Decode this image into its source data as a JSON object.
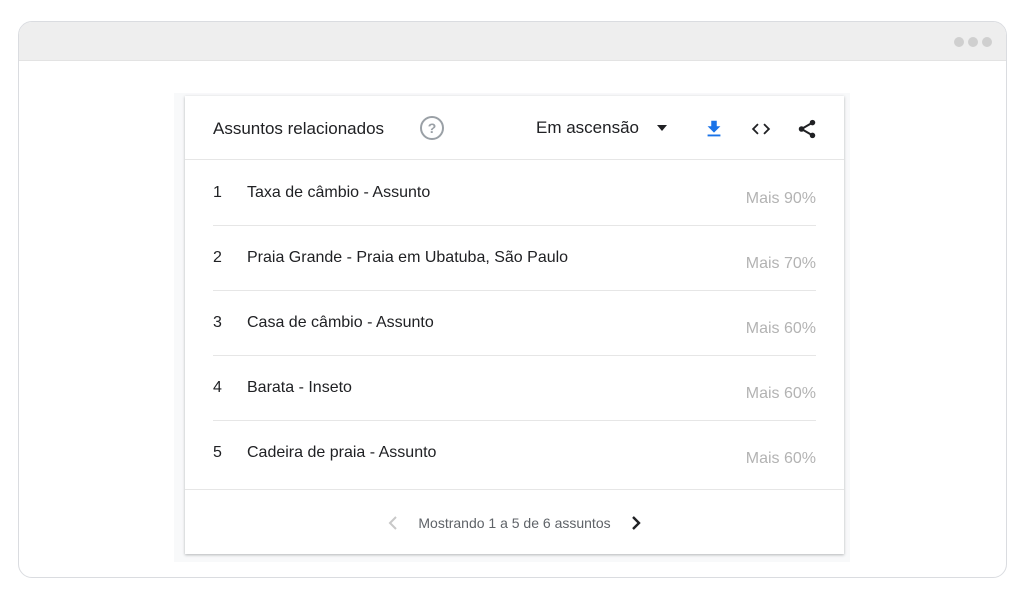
{
  "widget": {
    "title": "Assuntos relacionados",
    "help_icon": "help-circle-icon",
    "filter": {
      "selected": "Em ascensão"
    },
    "toolbar_icons": [
      "download-icon",
      "embed-code-icon",
      "share-icon"
    ]
  },
  "topics": [
    {
      "rank": "1",
      "name": "Taxa de câmbio - Assunto",
      "value": "Mais 90%"
    },
    {
      "rank": "2",
      "name": "Praia Grande - Praia em Ubatuba, São Paulo",
      "value": "Mais 70%"
    },
    {
      "rank": "3",
      "name": "Casa de câmbio - Assunto",
      "value": "Mais 60%"
    },
    {
      "rank": "4",
      "name": "Barata - Inseto",
      "value": "Mais 60%"
    },
    {
      "rank": "5",
      "name": "Cadeira de praia - Assunto",
      "value": "Mais 60%"
    }
  ],
  "pagination": {
    "text": "Mostrando 1 a 5 de 6 assuntos"
  },
  "colors": {
    "primary_text": "#202124",
    "secondary_text": "#5f6368",
    "value_text": "#b3b3b3",
    "divider": "#e6e6e6",
    "frame_bar": "#eeeeee"
  }
}
